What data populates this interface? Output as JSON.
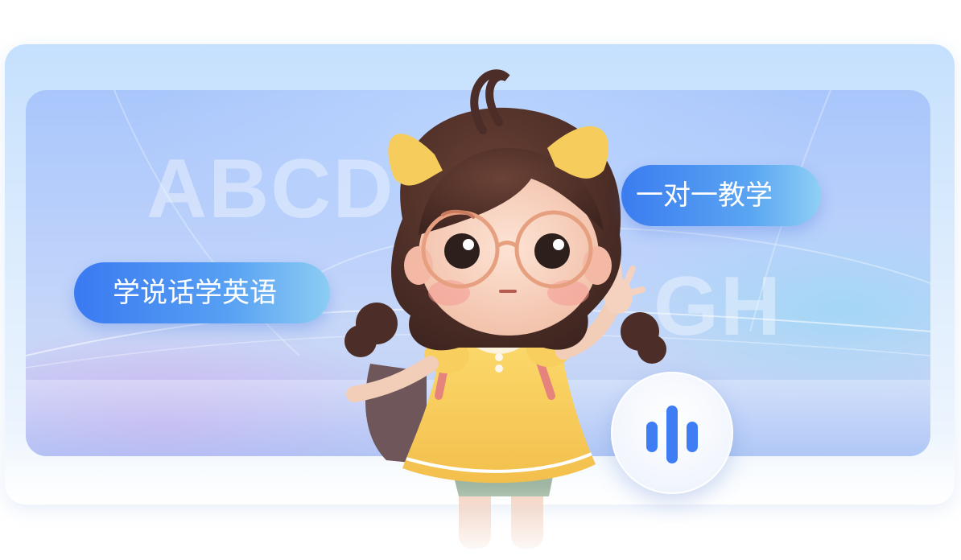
{
  "background_letters": {
    "line1": "ABCD",
    "line2": "GH"
  },
  "tags": {
    "left": "学说话学英语",
    "right": "一对一教学"
  },
  "voice_button": {
    "icon": "voice-wave-icon"
  },
  "colors": {
    "pill_start": "#3a79f2",
    "pill_end": "#8ccdf3",
    "stage_top": "#a9c6fb",
    "dress": "#f6cd5c"
  }
}
